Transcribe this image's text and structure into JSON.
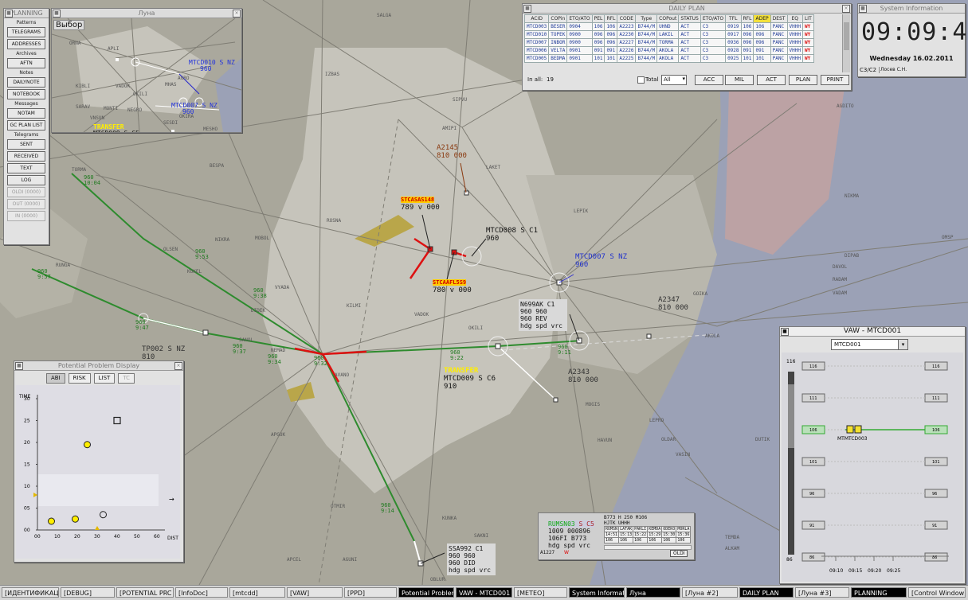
{
  "planning": {
    "title": "PLANNING",
    "sections": [
      {
        "header": "Patterns",
        "buttons": [
          {
            "label": "TELEGRAMS",
            "disabled": false
          },
          {
            "label": "ADDRESSES",
            "disabled": false
          }
        ]
      },
      {
        "header": "Archives",
        "buttons": [
          {
            "label": "AFTN",
            "disabled": false
          }
        ]
      },
      {
        "header": "Notes",
        "buttons": [
          {
            "label": "DAILYNOTE",
            "disabled": false
          },
          {
            "label": "NOTEBOOK",
            "disabled": false
          }
        ]
      },
      {
        "header": "Messages",
        "buttons": [
          {
            "label": "NOTAM",
            "disabled": false
          },
          {
            "label": "GC PLAN LIST",
            "disabled": false
          }
        ]
      },
      {
        "header": "Telegrams",
        "buttons": [
          {
            "label": "SENT",
            "disabled": false
          },
          {
            "label": "RECEIVED",
            "disabled": false
          },
          {
            "label": "TEXT",
            "disabled": false
          },
          {
            "label": "LOG",
            "disabled": false
          },
          {
            "label": "OLDI (0000)",
            "disabled": true
          },
          {
            "label": "OUT (0000)",
            "disabled": true
          },
          {
            "label": "IN (0000)",
            "disabled": true
          }
        ]
      }
    ]
  },
  "luna": {
    "title": "Луна",
    "select_label": "Выбор",
    "labels": [
      {
        "text": "MTCD010  S NZ",
        "sub": "960",
        "color": "#2233dd"
      },
      {
        "text": "MTCD007  S NZ",
        "sub": "960",
        "color": "#2233dd"
      },
      {
        "text": "TRANSFER",
        "sub": "",
        "color": "#ffee00"
      },
      {
        "text": "MTCD009  S C5",
        "sub": "910",
        "color": "#111111"
      }
    ],
    "fixes": [
      "ORNA",
      "APLI",
      "AGRO",
      "MHAS",
      "KIBLI",
      "VADOK",
      "OKILI",
      "NEGRO",
      "VNSUN",
      "MONTI",
      "SARAV",
      "SESDI",
      "OKIRA",
      "MESHO"
    ]
  },
  "daily_plan": {
    "title": "DAILY PLAN",
    "columns": [
      "ACID",
      "COPin",
      "ETO/ATO",
      "PEL",
      "RFL",
      "CODE",
      "Type",
      "COPout",
      "STATUS",
      "ETO/ATO",
      "TFL",
      "RFL",
      "ADEP",
      "DEST",
      "EQ",
      "LIT"
    ],
    "rows": [
      [
        "MTCD003",
        "BESER",
        "0904",
        "106",
        "106",
        "A2223",
        "B744/M",
        "UHND",
        "ACT",
        "C3",
        "0919",
        "106",
        "106",
        "PANC",
        "VHHH",
        "WY"
      ],
      [
        "MTCD010",
        "TOPEK",
        "0900",
        "096",
        "096",
        "A2230",
        "B744/M",
        "LAKIL",
        "ACT",
        "C3",
        "0917",
        "096",
        "096",
        "PANC",
        "VHHH",
        "WY"
      ],
      [
        "MTCD007",
        "INBOR",
        "0900",
        "096",
        "096",
        "A2227",
        "B744/M",
        "TORMA",
        "ACT",
        "C3",
        "0936",
        "096",
        "096",
        "PANC",
        "VHHH",
        "WY"
      ],
      [
        "MTCD006",
        "VELTA",
        "0901",
        "091",
        "091",
        "A2226",
        "B744/M",
        "AKOLA",
        "ACT",
        "C3",
        "0928",
        "091",
        "091",
        "PANC",
        "VHHH",
        "WY"
      ],
      [
        "MTCD005",
        "BEDMA",
        "0901",
        "101",
        "101",
        "A2225",
        "B744/M",
        "AKOLA",
        "ACT",
        "C3",
        "0925",
        "101",
        "101",
        "PANC",
        "VHHH",
        "WY"
      ]
    ],
    "in_all_label": "In all:",
    "in_all_count": "19",
    "total_label": "Total",
    "filter_value": "All",
    "buttons": [
      "ACC",
      "MIL",
      "ACT",
      "PLAN",
      "PRINT"
    ]
  },
  "sysinfo": {
    "title": "System Information",
    "time": "09:09:45",
    "date": "Wednesday 16.02.2011",
    "sector": "C3/C2",
    "user": "Лосев С.Н."
  },
  "ppd": {
    "title": "Potential Problem Display",
    "tabs": [
      "ABI",
      "RISK",
      "LIST",
      "TC"
    ],
    "y_label": "TIME",
    "x_label": "DIST",
    "y_ticks": [
      "30",
      "25",
      "20",
      "15",
      "10",
      "05",
      "00"
    ],
    "x_ticks": [
      "00",
      "10",
      "20",
      "30",
      "40",
      "50",
      "60"
    ],
    "points": [
      {
        "shape": "square",
        "x": 40,
        "y": 25,
        "fill": "none"
      },
      {
        "shape": "circle",
        "x": 25,
        "y": 19.5,
        "fill": "#ffee00"
      },
      {
        "shape": "circle",
        "x": 7,
        "y": 2,
        "fill": "#ffee00"
      },
      {
        "shape": "circle",
        "x": 19,
        "y": 2.5,
        "fill": "#ffee00"
      },
      {
        "shape": "circle",
        "x": 33,
        "y": 3.5,
        "fill": "none"
      }
    ]
  },
  "vaw": {
    "title": "VAW - MTCD001",
    "select_value": "MTCD001",
    "top_value": "116",
    "bottom_value": "86",
    "levels": [
      {
        "label": "116",
        "highlight": false
      },
      {
        "label": "111",
        "highlight": false
      },
      {
        "label": "106",
        "highlight": true
      },
      {
        "label": "101",
        "highlight": false
      },
      {
        "label": "96",
        "highlight": false
      },
      {
        "label": "91",
        "highlight": false
      },
      {
        "label": "86",
        "highlight": false
      }
    ],
    "track_label": "MTMTCD003",
    "times": [
      "09:10",
      "09:15",
      "09:20",
      "09:25"
    ]
  },
  "track_popup": {
    "lines": [
      "B773 H 250 M106",
      "HJTK UHHH"
    ],
    "callsign": "RUMSN03",
    "cls": "S C5",
    "values": [
      "1009  000896",
      "106FI B773",
      "hdg  spd  vrc"
    ],
    "headers": [
      "RUMSN",
      "LATAK",
      "PAKLI",
      "KEMDA",
      "ODEKO",
      "MORLA"
    ],
    "times": [
      "14:51",
      "15:13",
      "15:22",
      "15:29",
      "15:30",
      "15:36"
    ],
    "fls": [
      "106",
      "106",
      "106",
      "106",
      "106",
      "106"
    ],
    "footer_left": "A1227",
    "footer_flag": "W",
    "button": "OLDI"
  },
  "aircraft_labels": [
    {
      "id": "mtcd008",
      "lines": [
        "MTCD008  S C1",
        "  960"
      ],
      "color": "#111111"
    },
    {
      "id": "mtcd007",
      "lines": [
        "MTCD007  S NZ",
        "   960"
      ],
      "color": "#2233cc"
    },
    {
      "id": "a2145",
      "lines": [
        "A2145",
        "810  000"
      ],
      "color": "#8a3a10"
    },
    {
      "id": "stca1",
      "lines": [
        "STCA",
        "SAS148",
        "789 v 000"
      ],
      "color": "#111111"
    },
    {
      "id": "stca2",
      "lines": [
        "STCA",
        "AFL5S9",
        "780 v 000"
      ],
      "color": "#111111"
    },
    {
      "id": "n699ak",
      "lines": [
        "N699AK  C1",
        "960   960",
        "960   REV",
        "hdg  spd  vrc"
      ],
      "color": "#111111"
    },
    {
      "id": "a2347",
      "lines": [
        "A2347",
        " 810  000"
      ],
      "color": "#333333"
    },
    {
      "id": "a2343",
      "lines": [
        "A2343",
        " 810  000"
      ],
      "color": "#333333"
    },
    {
      "id": "transfer",
      "lines": [
        "TRANSFER",
        "MTCD009  S C6",
        "  910"
      ],
      "color": "#111111"
    },
    {
      "id": "tp002",
      "lines": [
        "TP002   S NZ",
        "  810"
      ],
      "color": "#333333"
    },
    {
      "id": "ssa992",
      "lines": [
        "SSA992  C1",
        "960   960",
        "960   DID",
        "hdg  spd  vrc"
      ],
      "color": "#111111"
    }
  ],
  "fixes": [
    "TORMA",
    "RUNGA",
    "KUKEL",
    "VYADA",
    "NIKRA",
    "MOBOL",
    "OLSEN",
    "DIDEK",
    "KILMI",
    "SANOL",
    "NEMAD",
    "AVANO",
    "APGUK",
    "OTMIR",
    "APCEL",
    "AGUNI",
    "KUNKA",
    "OBLUR",
    "SAKNI",
    "MOGIS",
    "HAVUN",
    "LEPRO",
    "OLDAR",
    "VASIN",
    "AKOLA",
    "GOIKA",
    "OKILI",
    "VADOK",
    "AMIPI",
    "SIPVU",
    "LAKET",
    "LEPIK",
    "NIKMA",
    "IZBAS",
    "SALGA",
    "DIPAB",
    "AGDITO",
    "DAVOL",
    "RADAM",
    "VADAM",
    "OMSP",
    "KUNAC",
    "BESPA",
    "ROSNA",
    "DUTIK",
    "TEMDA",
    "ALKAM"
  ],
  "route_times": [
    {
      "fl": "960",
      "t": "10:04"
    },
    {
      "fl": "960",
      "t": "9:57"
    },
    {
      "fl": "960",
      "t": "9:53"
    },
    {
      "fl": "960",
      "t": "9:47"
    },
    {
      "fl": "960",
      "t": "9:38"
    },
    {
      "fl": "960",
      "t": "9:37"
    },
    {
      "fl": "960",
      "t": "9:34"
    },
    {
      "fl": "960",
      "t": "9:32"
    },
    {
      "fl": "960",
      "t": "9:22"
    },
    {
      "fl": "960",
      "t": "9:11"
    },
    {
      "fl": "960",
      "t": "9:14"
    }
  ],
  "taskbar": [
    {
      "label": "[ИДЕНТИФИКАЦИ",
      "active": false
    },
    {
      "label": "[DEBUG]",
      "active": false
    },
    {
      "label": "[POTENTIAL PRC",
      "active": false
    },
    {
      "label": "[InfoDoc]",
      "active": false
    },
    {
      "label": "[mtcdd]",
      "active": false
    },
    {
      "label": "[VAW]",
      "active": false
    },
    {
      "label": "[PPD]",
      "active": false
    },
    {
      "label": "Potential Problem",
      "active": true
    },
    {
      "label": "VAW - MTCD001",
      "active": true
    },
    {
      "label": "[METEO]",
      "active": false
    },
    {
      "label": "System Informatic",
      "active": true
    },
    {
      "label": "Луна",
      "active": true
    },
    {
      "label": "[Луна #2]",
      "active": false
    },
    {
      "label": "DAILY PLAN",
      "active": true
    },
    {
      "label": "[Луна #3]",
      "active": false
    },
    {
      "label": "PLANNING",
      "active": true
    },
    {
      "label": "[Control Window]",
      "active": false
    }
  ],
  "colors": {
    "background": "#a9a79b",
    "sector": "#c8c7bd",
    "route_green": "#2a8a2a",
    "conflict_red": "#dd1111",
    "water": "#9aa0b8",
    "restricted": "#c7a2a0"
  }
}
